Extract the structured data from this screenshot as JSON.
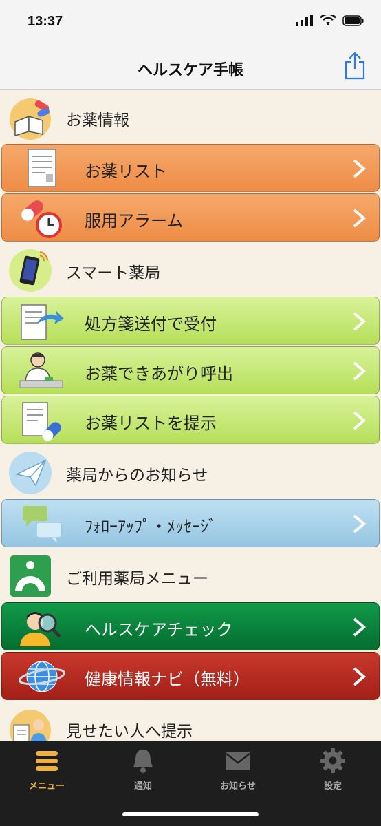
{
  "status_bar": {
    "time": "13:37"
  },
  "nav": {
    "title": "ヘルスケア手帳"
  },
  "sections": {
    "medicine": {
      "title": "お薬情報",
      "items": [
        {
          "label": "お薬リスト"
        },
        {
          "label": "服用アラーム"
        }
      ]
    },
    "smart": {
      "title": "スマート薬局",
      "items": [
        {
          "label": "処方箋送付で受付"
        },
        {
          "label": "お薬できあがり呼出"
        },
        {
          "label": "お薬リストを提示"
        }
      ]
    },
    "news": {
      "title": "薬局からのお知らせ",
      "items": [
        {
          "label": "ﾌｫﾛｰｱｯﾌﾟ・ﾒｯｾｰｼﾞ"
        }
      ]
    },
    "pharmacy_menu": {
      "title": "ご利用薬局メニュー",
      "items": [
        {
          "label": "ヘルスケアチェック"
        },
        {
          "label": "健康情報ナビ（無料）"
        }
      ]
    },
    "show": {
      "title": "見せたい人へ提示"
    }
  },
  "tabs": [
    {
      "label": "メニュー",
      "icon": "menu-icon",
      "active": true
    },
    {
      "label": "通知",
      "icon": "bell-icon"
    },
    {
      "label": "お知らせ",
      "icon": "mail-icon"
    },
    {
      "label": "設定",
      "icon": "gear-icon"
    }
  ],
  "colors": {
    "medicine_row": "#ee8c46",
    "smart_row": "#b6df58",
    "news_row": "#95c5e2",
    "check_row": "#056d30",
    "navi_row": "#a32018",
    "tab_active": "#f1b142"
  }
}
